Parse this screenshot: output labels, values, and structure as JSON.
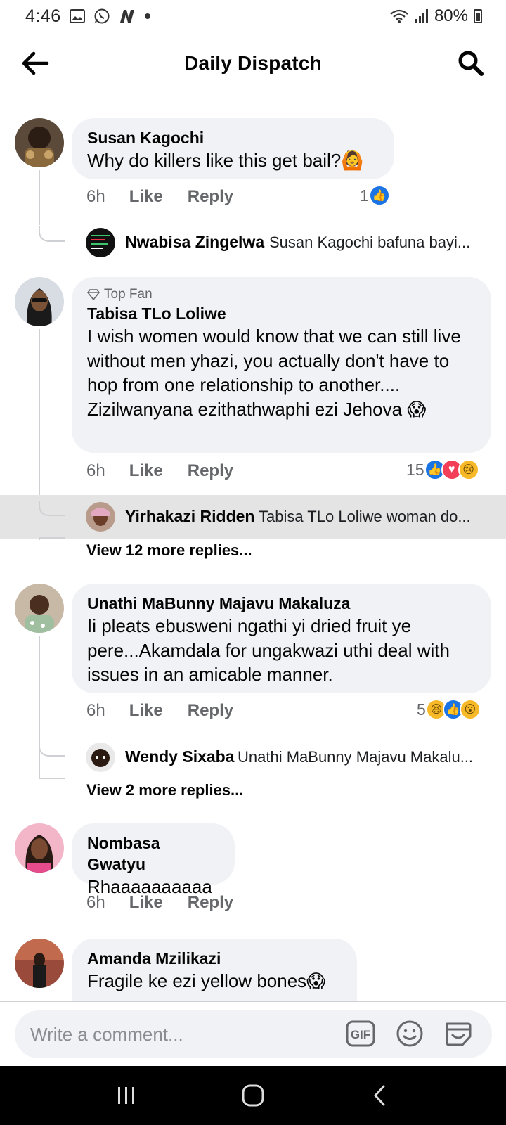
{
  "status_bar": {
    "time": "4:46",
    "battery": "80%",
    "icons": [
      "gallery-icon",
      "whatsapp-icon",
      "n-app-icon",
      "dot-icon",
      "wifi-icon",
      "signal-icon",
      "battery-icon"
    ]
  },
  "header": {
    "title": "Daily Dispatch",
    "back_icon": "back-arrow-icon",
    "search_icon": "search-icon"
  },
  "comments": [
    {
      "author": "Susan Kagochi",
      "text": "Why do killers like this get bail?",
      "emoji": "🙆",
      "time": "6h",
      "like_label": "Like",
      "reply_label": "Reply",
      "reaction_count": "1",
      "reply": {
        "name": "Nwabisa Zingelwa",
        "preview": "Susan Kagochi bafuna bayi..."
      }
    },
    {
      "badge": "Top Fan",
      "author": "Tabisa TLo Loliwe",
      "text": "I wish women would know that we can still live without men yhazi, you actually don't have to hop from one relationship to another.... Zizilwanyana ezithathwaphi ezi Jehova",
      "emoji": "😱",
      "time": "6h",
      "like_label": "Like",
      "reply_label": "Reply",
      "reaction_count": "15",
      "reply": {
        "name": "Yirhakazi Ridden",
        "preview": "Tabisa TLo Loliwe woman do..."
      },
      "view_more": "View 12 more replies..."
    },
    {
      "author": "Unathi MaBunny Majavu Makaluza",
      "text": "Ii pleats ebusweni ngathi yi dried fruit ye pere...Akamdala for ungakwazi uthi deal with issues in an amicable manner.",
      "time": "6h",
      "like_label": "Like",
      "reply_label": "Reply",
      "reaction_count": "5",
      "reply": {
        "name": "Wendy Sixaba",
        "preview": "Unathi MaBunny Majavu Makalu..."
      },
      "view_more": "View 2 more replies..."
    },
    {
      "author": "Nombasa Gwatyu",
      "text": "Rhaaaaaaaaaa",
      "time": "6h",
      "like_label": "Like",
      "reply_label": "Reply"
    },
    {
      "author": "Amanda Mzilikazi",
      "text": "Fragile ke ezi yellow bones",
      "emoji": "😱"
    }
  ],
  "composer": {
    "placeholder": "Write a comment...",
    "gif_label": "GIF",
    "icons": [
      "gif-icon",
      "emoji-icon",
      "sticker-icon"
    ]
  },
  "navbar": {
    "icons": [
      "recent-apps-icon",
      "home-icon",
      "back-icon"
    ]
  },
  "colors": {
    "bubble": "#f0f2f5",
    "secondary_text": "#65676b",
    "like_blue": "#1b74e4",
    "love_red": "#f33e58",
    "emoji_yellow": "#f7b928"
  }
}
